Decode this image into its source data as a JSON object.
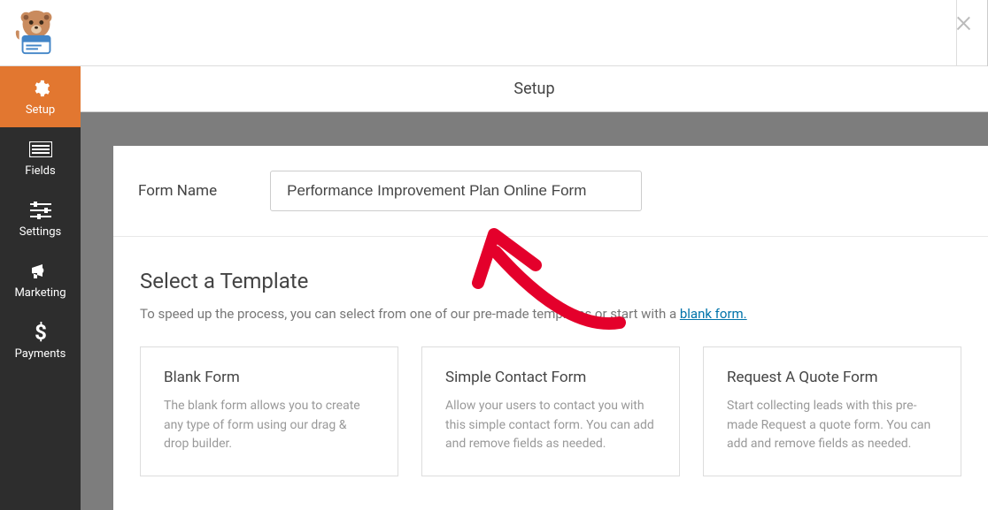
{
  "header": {
    "page_title": "Setup"
  },
  "sidebar": {
    "items": [
      {
        "label": "Setup",
        "icon": "gear",
        "active": true
      },
      {
        "label": "Fields",
        "icon": "list",
        "active": false
      },
      {
        "label": "Settings",
        "icon": "sliders",
        "active": false
      },
      {
        "label": "Marketing",
        "icon": "bullhorn",
        "active": false
      },
      {
        "label": "Payments",
        "icon": "dollar",
        "active": false
      }
    ]
  },
  "form_name": {
    "label": "Form Name",
    "value": "Performance Improvement Plan Online Form"
  },
  "templates": {
    "title": "Select a Template",
    "desc_prefix": "To speed up the process, you can select from one of our pre-made templates or start with a ",
    "desc_link": "blank form.",
    "cards": [
      {
        "title": "Blank Form",
        "desc": "The blank form allows you to create any type of form using our drag & drop builder."
      },
      {
        "title": "Simple Contact Form",
        "desc": "Allow your users to contact you with this simple contact form. You can add and remove fields as needed."
      },
      {
        "title": "Request A Quote Form",
        "desc": "Start collecting leads with this pre-made Request a quote form. You can add and remove fields as needed."
      }
    ]
  }
}
